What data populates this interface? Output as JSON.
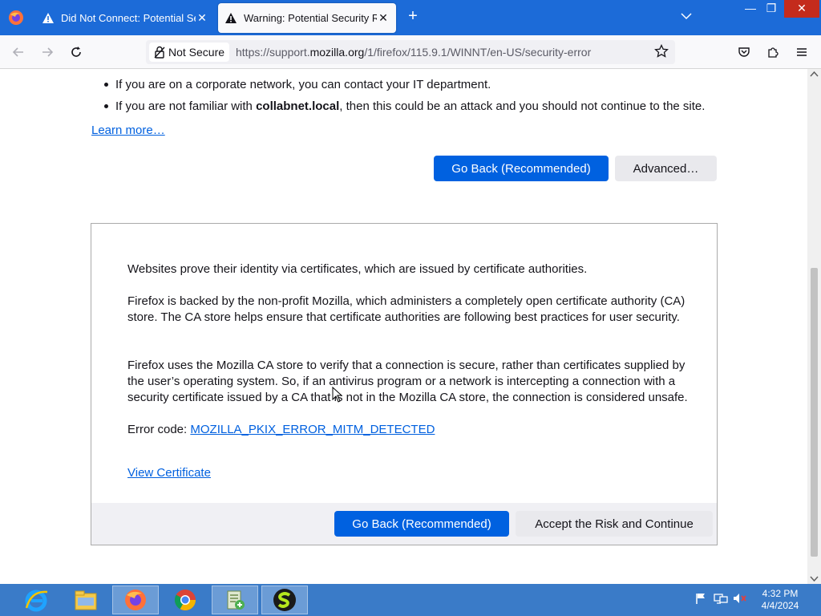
{
  "browser": {
    "tabs": [
      {
        "title": "Did Not Connect: Potential Security Issue",
        "active": false
      },
      {
        "title": "Warning: Potential Security Risk Ahead",
        "active": true
      }
    ],
    "identity_label": "Not Secure",
    "url": {
      "prefix": "https://support.",
      "host": "mozilla.org",
      "path": "/1/firefox/115.9.1/WINNT/en-US/security-error"
    }
  },
  "page": {
    "bullet_1": "If you are on a corporate network, you can contact your IT department.",
    "bullet_2_pre": "If you are not familiar with ",
    "bullet_2_host": "collabnet.local",
    "bullet_2_post": ", then this could be an attack and you should not continue to the site.",
    "learn_more": "Learn more…",
    "go_back_label": "Go Back (Recommended)",
    "advanced_label": "Advanced…",
    "advanced_panel": {
      "para_1": "Websites prove their identity via certificates, which are issued by certificate authorities.",
      "para_2": "Firefox is backed by the non-profit Mozilla, which administers a completely open certificate authority (CA) store. The CA store helps ensure that certificate authorities are following best practices for user security.",
      "para_3": "Firefox uses the Mozilla CA store to verify that a connection is secure, rather than certificates supplied by the user’s operating system. So, if an antivirus program or a network is intercepting a connection with a security certificate issued by a CA that is not in the Mozilla CA store, the connection is considered unsafe.",
      "error_code_label": "Error code: ",
      "error_code": "MOZILLA_PKIX_ERROR_MITM_DETECTED",
      "view_certificate": "View Certificate",
      "go_back_label": "Go Back (Recommended)",
      "accept_label": "Accept the Risk and Continue"
    }
  },
  "taskbar": {
    "apps": [
      "internet-explorer",
      "file-explorer",
      "firefox",
      "chrome",
      "network-tool",
      "app-s"
    ],
    "time": "4:32 PM",
    "date": "4/4/2024"
  },
  "colors": {
    "tabbar": "#1c6bd8",
    "primary_button": "#0061e0",
    "link": "#0060df",
    "taskbar": "#3a7bc8"
  }
}
